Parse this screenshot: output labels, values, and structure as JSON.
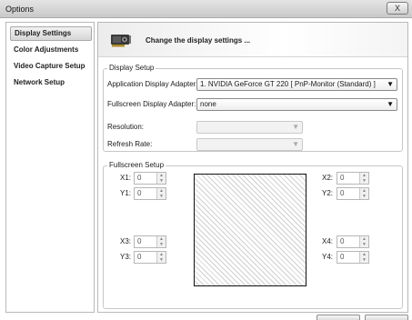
{
  "window": {
    "title": "Options",
    "close_glyph": "X"
  },
  "sidebar": {
    "items": [
      {
        "label": "Display Settings",
        "active": true
      },
      {
        "label": "Color Adjustments",
        "active": false
      },
      {
        "label": "Video Capture Setup",
        "active": false
      },
      {
        "label": "Network Setup",
        "active": false
      }
    ]
  },
  "banner": {
    "text": "Change the display settings ...",
    "icon": "graphics-card-icon"
  },
  "display_setup": {
    "legend": "Display Setup",
    "app_adapter_label": "Application Display Adapter:",
    "app_adapter_value": "1. NVIDIA GeForce GT 220 [ PnP-Monitor (Standard) ]",
    "fullscreen_adapter_label": "Fullscreen Display Adapter:",
    "fullscreen_adapter_value": "none",
    "resolution_label": "Resolution:",
    "resolution_value": "",
    "refresh_label": "Refresh Rate:",
    "refresh_value": ""
  },
  "fullscreen_setup": {
    "legend": "Fullscreen Setup",
    "x1": {
      "label": "X1:",
      "value": "0"
    },
    "y1": {
      "label": "Y1:",
      "value": "0"
    },
    "x2": {
      "label": "X2:",
      "value": "0"
    },
    "y2": {
      "label": "Y2:",
      "value": "0"
    },
    "x3": {
      "label": "X3:",
      "value": "0"
    },
    "y3": {
      "label": "Y3:",
      "value": "0"
    },
    "x4": {
      "label": "X4:",
      "value": "0"
    },
    "y4": {
      "label": "Y4:",
      "value": "0"
    }
  },
  "glyphs": {
    "combo_arrow": "▼",
    "spin_up": "▲",
    "spin_down": "▼"
  }
}
